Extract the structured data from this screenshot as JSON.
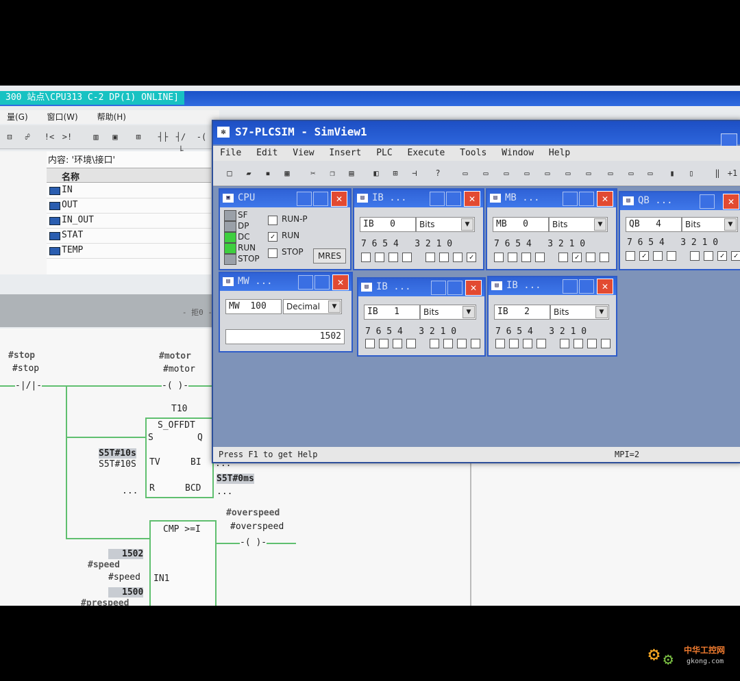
{
  "step7": {
    "title": "300 站点\\CPU313 C-2 DP(1)  ONLINE]",
    "menu": [
      "量(G)",
      "窗口(W)",
      "帮助(H)"
    ],
    "interface_caption": "内容: '环境\\接口'",
    "interface_header": "名称",
    "interface_rows": [
      "IN",
      "OUT",
      "IN_OUT",
      "STAT",
      "TEMP"
    ],
    "scroll_hint": "- 拒0 -"
  },
  "ladder": {
    "stop_symbol": "#stop",
    "stop_operand": "#stop",
    "motor_symbol": "#motor",
    "motor_operand": "#motor",
    "timer_name": "T10",
    "timer_type": "S_OFFDT",
    "timer_pin_s": "S",
    "timer_pin_q": "Q",
    "timer_pin_tv": "TV",
    "timer_pin_bi": "BI",
    "timer_pin_r": "R",
    "timer_pin_bcd": "BCD",
    "tv_value": "S5T#10s",
    "tv_operand": "S5T#10S",
    "r_operand": "...",
    "bi_operand": "...",
    "bcd_value": "S5T#0ms",
    "bcd_operand": "...",
    "overspeed_symbol": "#overspeed",
    "overspeed_operand": "#overspeed",
    "cmp_type": "CMP >=I",
    "cmp_in1_pin": "IN1",
    "speed_value": "1502",
    "speed_symbol": "#speed",
    "speed_operand": "#speed",
    "prespeed_value": "1500",
    "prespeed_symbol": "#prespeed",
    "coil_glyph": "-( )-",
    "contact_glyph": "-|/|-"
  },
  "plcsim": {
    "title": "S7-PLCSIM - SimView1",
    "menu": [
      "File",
      "Edit",
      "View",
      "Insert",
      "PLC",
      "Execute",
      "Tools",
      "Window",
      "Help"
    ],
    "status_left": "Press F1 to get Help",
    "status_right": "MPI=2",
    "cpu": {
      "title": "CPU",
      "leds": [
        "SF",
        "DP",
        "DC",
        "RUN",
        "STOP"
      ],
      "modes": [
        "RUN-P",
        "RUN",
        "STOP"
      ],
      "mode_checked": [
        false,
        true,
        false
      ],
      "mres": "MRES"
    },
    "bit_header": "7 6 5 4   3 2 1 0",
    "panels": [
      {
        "title": "IB  ...",
        "area": "IB",
        "addr": "0",
        "format": "Bits",
        "bits": [
          false,
          false,
          false,
          false,
          false,
          false,
          false,
          true
        ]
      },
      {
        "title": "MB  ...",
        "area": "MB",
        "addr": "0",
        "format": "Bits",
        "bits": [
          false,
          false,
          false,
          false,
          false,
          true,
          false,
          false
        ]
      },
      {
        "title": "QB  ...",
        "area": "QB",
        "addr": "4",
        "format": "Bits",
        "bits": [
          false,
          true,
          false,
          false,
          false,
          false,
          true,
          true
        ]
      },
      {
        "title": "IB  ...",
        "area": "IB",
        "addr": "1",
        "format": "Bits",
        "bits": [
          false,
          false,
          false,
          false,
          false,
          false,
          false,
          false
        ]
      },
      {
        "title": "IB  ...",
        "area": "IB",
        "addr": "2",
        "format": "Bits",
        "bits": [
          false,
          false,
          false,
          false,
          false,
          false,
          false,
          false
        ]
      }
    ],
    "mw": {
      "title": "MW  ...",
      "area": "MW",
      "addr": "100",
      "format": "Decimal",
      "value": "1502"
    }
  },
  "watermark": {
    "line1": "中华工控网",
    "line2": "gkong.com"
  }
}
